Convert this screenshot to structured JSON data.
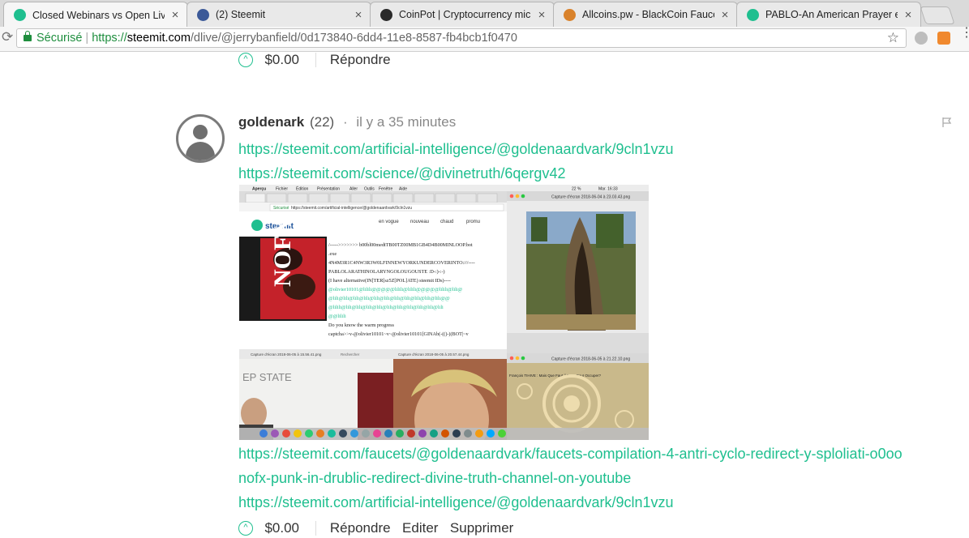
{
  "tabs": [
    {
      "title": "Closed Webinars vs Open Live",
      "favicon": "steemit-icon",
      "color": "#1fbf8f",
      "active": true
    },
    {
      "title": "(2) Steemit",
      "favicon": "facebook-icon",
      "color": "#3b5998",
      "active": false
    },
    {
      "title": "CoinPot | Cryptocurrency micr",
      "favicon": "coinpot-icon",
      "color": "#2a2a2a",
      "active": false
    },
    {
      "title": "Allcoins.pw - BlackCoin Fauce",
      "favicon": "allcoins-icon",
      "color": "#d9822b",
      "active": false
    },
    {
      "title": "PABLO-An American Prayer ex",
      "favicon": "steemit-icon",
      "color": "#1fbf8f",
      "active": false
    }
  ],
  "address": {
    "secure_label": "Sécurisé",
    "scheme": "https://",
    "host": "steemit.com",
    "path": "/dlive/@jerrybanfield/0d173840-6dd4-11e8-8587-fb4bcb1f0470"
  },
  "colors": {
    "accent": "#1fbf8f",
    "secure": "#1e8e3e"
  },
  "top_comment": {
    "amount": "$0.00",
    "reply_label": "Répondre"
  },
  "comment": {
    "author": "goldenark",
    "reputation": "(22)",
    "separator": "·",
    "time": "il y a 35 minutes",
    "links": [
      "https://steemit.com/artificial-intelligence/@goldenaardvark/9cln1vzu",
      "https://steemit.com/science/@divinetruth/6qergv42"
    ],
    "links_after": [
      "https://steemit.com/faucets/@goldenaardvark/faucets-compilation-4-antri-cyclo-redirect-y-sploliati-o0oo",
      "nofx-punk-in-drublic-redirect-divine-truth-channel-on-youtube",
      "https://steemit.com/artificial-intelligence/@goldenaardvark/9cln1vzu"
    ],
    "amount": "$0.00",
    "actions": {
      "reply": "Répondre",
      "edit": "Editer",
      "delete": "Supprimer"
    }
  },
  "screenshot": {
    "menubar": [
      "Aperçu",
      "Fichier",
      "Édition",
      "Présentation",
      "Aller",
      "Outils",
      "Fenêtre",
      "Aide"
    ],
    "clock": "Mar. 16:33",
    "battery": "22 %",
    "inner_url_secure": "Sécurisé",
    "inner_url": "https://steemit.com/artificial-intelligence/@goldenaardvark/9cln1vzu",
    "brand": "steemit",
    "nav": [
      "en vogue",
      "nouveau",
      "chaud",
      "promu"
    ],
    "album_text": "NOFX",
    "text_lines": [
      "/----->>>>>>> b00bl00medtTB00TZ00MB1GB4D4B00MINLOOP.bot",
      ".exe",
      "4N4M3R1C4NW3R3W0LFINNEWYORKUNDERCOVERINTO:///----",
      "PABLOLARATHINOLARYNGOLOUGOUSTE :D-:)-:-)",
      "(I have alternative(IN[TER[sz5Z[POL]ATE) steemit IDs)----",
      "@olivier10101@lilili@@@@@lilili@lilili@@@@@lilili@lili@",
      "@lili@lili@lili@lili@lili@lili@lili@lili@lili@lili@lili@@",
      "@lilili@lili@lili@lili@lili@lili@lili@lili@lili@lili@lili",
      "@@lilili",
      "Do you know the warm progress",
      "captcha>>v-@olivier10101~v~@olivier10101[GINAb(-(()-)(BOT|~v"
    ],
    "capture_top_right": "Capture d'écran 2018-06-04 à 23.03.43.png",
    "capture_bottom_left": "Capture d'écran 2018-06-05 à 15.56.41.png",
    "capture_bottom_mid": "Capture d'écran 2018-06-05 à 20.57.44.png",
    "capture_bottom_right": "Capture d'écran 2018-06-05 à 21.22.10.png",
    "search_label": "Rechercher",
    "whiteboard_text": "EP STATE",
    "caption_strip": "François TIHIVE : Mais Que Faut-il Donc Pour Occuper?"
  }
}
